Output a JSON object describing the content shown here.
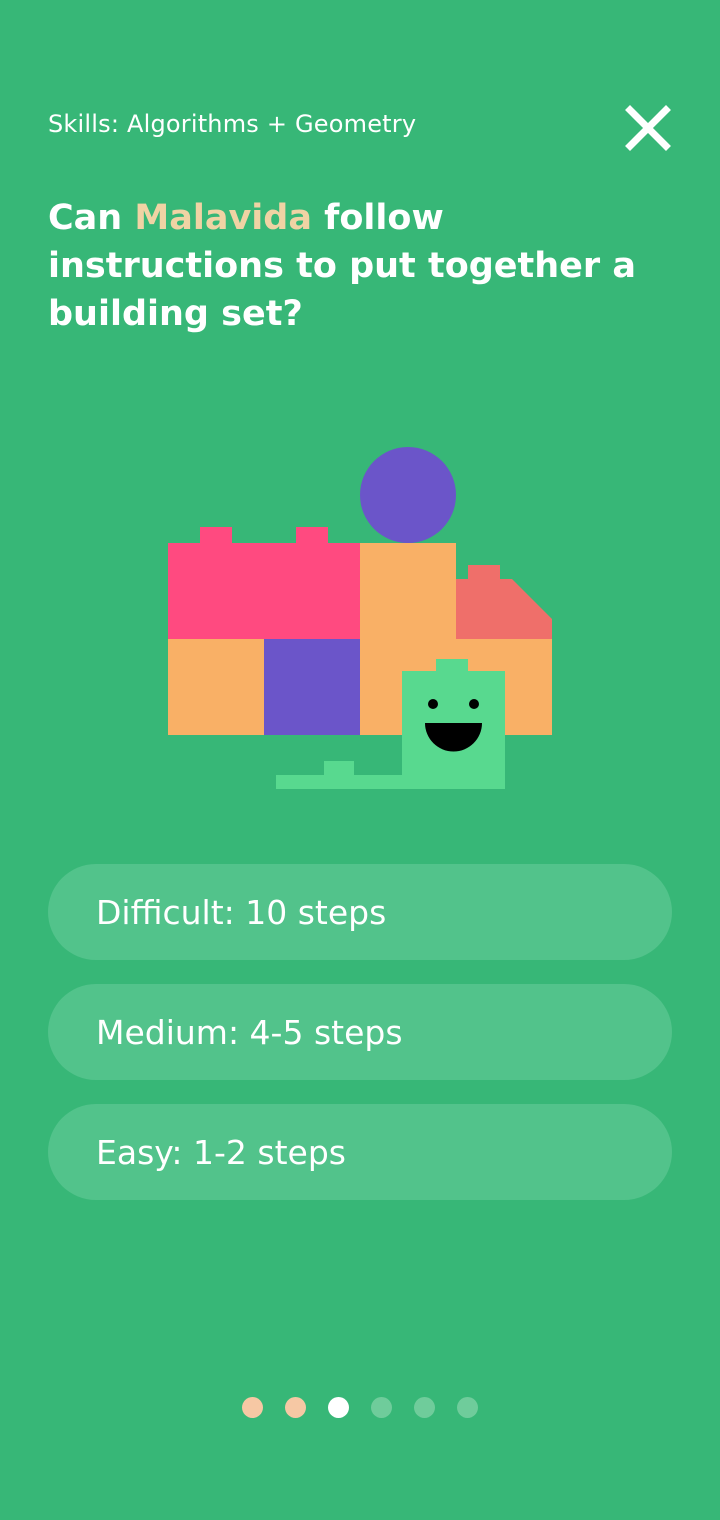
{
  "header": {
    "skills_label": "Skills: Algorithms + Geometry"
  },
  "question": {
    "prefix": "Can ",
    "highlight": "Malavida",
    "suffix": " follow instructions to put together a building set?"
  },
  "options": [
    {
      "label": "Difficult: 10 steps"
    },
    {
      "label": "Medium: 4-5 steps"
    },
    {
      "label": "Easy: 1-2 steps"
    }
  ],
  "pagination": {
    "total": 6,
    "current": 3
  },
  "colors": {
    "background": "#37b777",
    "highlight": "#f0d3a4",
    "option_bg": "#52c38b",
    "dot_done": "#f6c8a4",
    "dot_active": "#ffffff",
    "dot_pending": "#6fcc9b"
  },
  "icons": {
    "close": "close-icon"
  }
}
